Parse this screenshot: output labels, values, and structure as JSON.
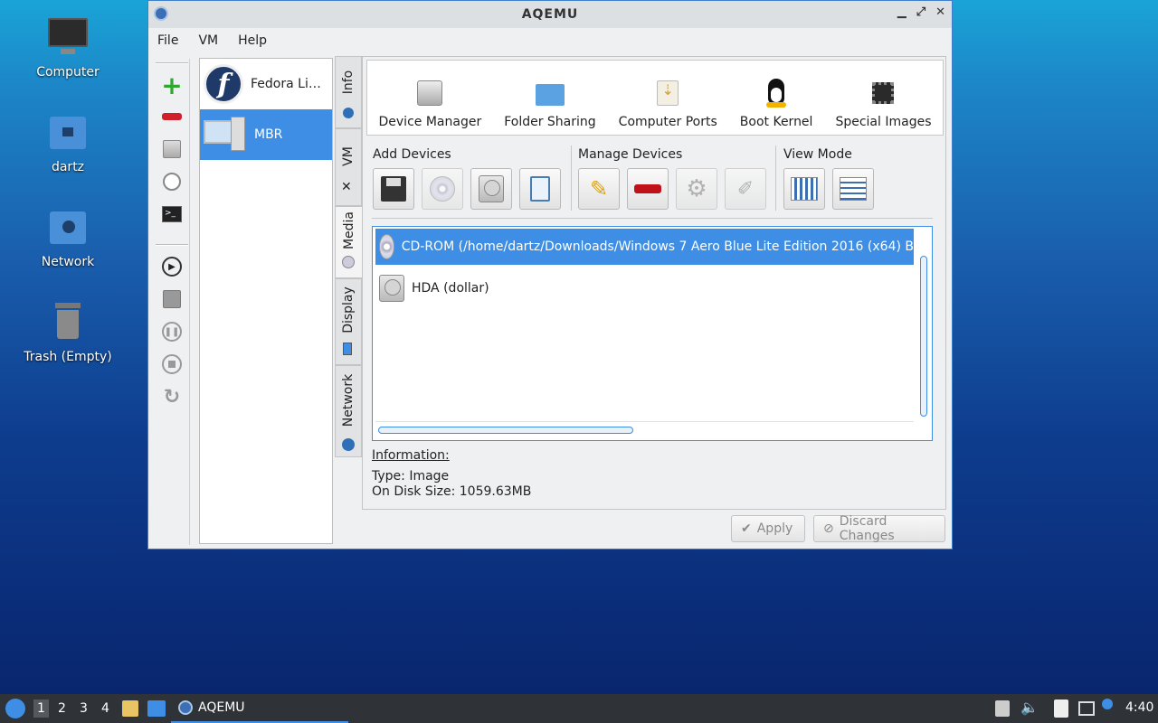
{
  "desktop": {
    "icons": [
      {
        "label": "Computer",
        "icon": "monitor-icon"
      },
      {
        "label": "dartz",
        "icon": "home-folder-icon"
      },
      {
        "label": "Network",
        "icon": "network-folder-icon"
      },
      {
        "label": "Trash (Empty)",
        "icon": "trash-icon"
      }
    ]
  },
  "window": {
    "title": "AQEMU",
    "controls": {
      "minimize": "▁",
      "maximize": "⤢",
      "close": "✕"
    }
  },
  "menu": [
    "File",
    "VM",
    "Help"
  ],
  "vm_list": [
    {
      "name": "Fedora Li…",
      "icon": "fedora-icon",
      "selected": false
    },
    {
      "name": "MBR",
      "icon": "computer-icon",
      "selected": true
    }
  ],
  "tabs": [
    {
      "label": "Info"
    },
    {
      "label": "VM"
    },
    {
      "label": "Media",
      "active": true
    },
    {
      "label": "Display"
    },
    {
      "label": "Network"
    }
  ],
  "top_icons": [
    {
      "label": "Device Manager",
      "icon": "harddisk-icon"
    },
    {
      "label": "Folder Sharing",
      "icon": "folder-icon"
    },
    {
      "label": "Computer Ports",
      "icon": "usb-icon"
    },
    {
      "label": "Boot Kernel",
      "icon": "tux-icon"
    },
    {
      "label": "Special Images",
      "icon": "chip-icon"
    }
  ],
  "groups": {
    "add": "Add Devices",
    "manage": "Manage Devices",
    "view": "View Mode"
  },
  "devices": [
    {
      "label": "CD-ROM (/home/dartz/Downloads/Windows 7 Aero Blue Lite Edition 2016 (x64) B",
      "icon": "cdrom-icon",
      "selected": true
    },
    {
      "label": "HDA (dollar)",
      "icon": "harddisk-icon",
      "selected": false
    }
  ],
  "information": {
    "heading": "Information:",
    "type": "Type: Image",
    "size": "On Disk Size: 1059.63MB"
  },
  "buttons": {
    "apply": "Apply",
    "discard": "Discard Changes"
  },
  "taskbar": {
    "workspaces": [
      "1",
      "2",
      "3",
      "4"
    ],
    "task": "AQEMU",
    "clock": "4:40"
  },
  "colors": {
    "selection": "#3d8ee4",
    "titlebar": "#dde0e3",
    "taskbar": "#2f3338"
  }
}
